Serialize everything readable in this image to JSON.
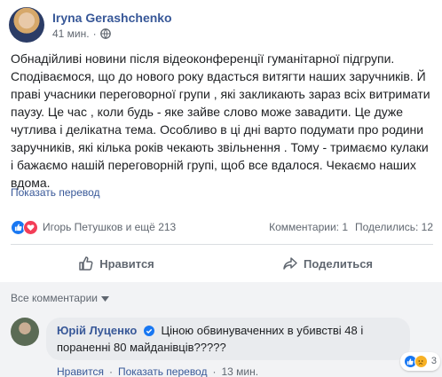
{
  "post": {
    "author": "Iryna Gerashchenko",
    "time": "41 мин.",
    "separator": "·",
    "text_lines": [
      "Обнадійливі новини після відеоконференції гуманітарної підгрупи.",
      "Сподіваємося, що до нового року вдасться витягти наших заручників. Й",
      "праві учасники переговорної групи , які закликають зараз всіх витримати",
      "паузу. Це час , коли будь - яке зайве слово може завадити. Це дуже",
      "чутлива і делікатна тема. Особливо в ці дні варто подумати про родини",
      "заручників, які кілька років чекають звільнення . Тому - тримаємо кулаки",
      "і бажаємо нашій переговорній групі, щоб все вдалося. Чекаємо наших",
      "вдома."
    ],
    "translate_label": "Показать перевод"
  },
  "reactions": {
    "summary": "Игорь Петушков и ещё 213",
    "comments_count": "Комментарии: 1",
    "shares_count": "Поделились: 12"
  },
  "actions": {
    "like_label": "Нравится",
    "share_label": "Поделиться"
  },
  "comments": {
    "filter_label": "Все комментарии",
    "items": [
      {
        "author": "Юрій Луценко",
        "text": "Ціною обвинуваченних в убивстві 48 і пораненні 80 майданівців?????",
        "like_label": "Нравится",
        "translate_label": "Показать перевод",
        "time": "13 мин.",
        "separator": "·",
        "reaction_count": "3"
      }
    ]
  },
  "colors": {
    "link": "#385898",
    "like": "#1877f2",
    "love": "#f33e58",
    "muted": "#606770"
  }
}
